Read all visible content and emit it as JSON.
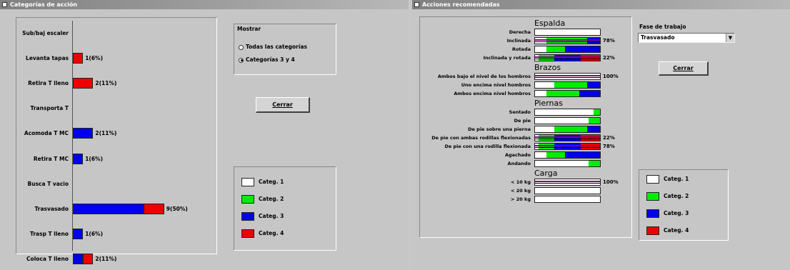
{
  "left_window": {
    "title": "Categorías de acción",
    "mostrar_label": "Mostrar",
    "radio_all": "Todas las categorías",
    "radio_34": "Categorías 3 y 4",
    "close_label": "Cerrar",
    "legend": [
      {
        "label": "Categ. 1",
        "color": "#ffffff"
      },
      {
        "label": "Categ. 2",
        "color": "#00ee00"
      },
      {
        "label": "Categ. 3",
        "color": "#0000ee"
      },
      {
        "label": "Categ. 4",
        "color": "#ee0000"
      }
    ]
  },
  "chart_data": {
    "type": "bar",
    "orientation": "horizontal",
    "categories": [
      "Sub/baj escaler",
      "Levanta tapas",
      "Retira T lleno",
      "Transporta T",
      "Acomoda T MC",
      "Retira T MC",
      "Busca T vacio",
      "Trasvasado",
      "Trasp T lleno",
      "Coloca T lleno"
    ],
    "series": [
      {
        "name": "Categ. 3",
        "values": [
          0,
          0,
          0,
          0,
          2,
          1,
          0,
          7,
          1,
          1
        ]
      },
      {
        "name": "Categ. 4",
        "values": [
          0,
          1,
          2,
          0,
          0,
          0,
          0,
          2,
          0,
          1
        ]
      }
    ],
    "data_labels": [
      "",
      "1(6%)",
      "2(11%)",
      "",
      "2(11%)",
      "1(6%)",
      "",
      "9(50%)",
      "1(6%)",
      "2(11%)"
    ],
    "xlim": [
      0,
      9
    ]
  },
  "right_window": {
    "title": "Acciones recomendadas",
    "fase_label": "Fase de trabajo",
    "fase_value": "Trasvasado",
    "close_label": "Cerrar",
    "legend": [
      {
        "label": "Categ. 1",
        "color": "#ffffff"
      },
      {
        "label": "Categ. 2",
        "color": "#00ee00"
      },
      {
        "label": "Categ. 3",
        "color": "#0000ee"
      },
      {
        "label": "Categ. 4",
        "color": "#ee0000"
      }
    ],
    "groups": [
      {
        "title": "Espalda",
        "rows": [
          {
            "label": "Derecha",
            "marked": false,
            "pct": ""
          },
          {
            "label": "Inclinada",
            "marked": true,
            "pct": "78%"
          },
          {
            "label": "Rotada",
            "marked": false,
            "pct": ""
          },
          {
            "label": "Inclinada y rotada",
            "marked": true,
            "pct": "22%"
          }
        ]
      },
      {
        "title": "Brazos",
        "rows": [
          {
            "label": "Ambos bajo el nivel de los hombros",
            "marked": true,
            "pct": "100%"
          },
          {
            "label": "Uno encima nivel hombros",
            "marked": false,
            "pct": ""
          },
          {
            "label": "Ambos encima nivel hombros",
            "marked": false,
            "pct": ""
          }
        ]
      },
      {
        "title": "Piernas",
        "rows": [
          {
            "label": "Sentado",
            "marked": false,
            "pct": ""
          },
          {
            "label": "De pie",
            "marked": false,
            "pct": ""
          },
          {
            "label": "De pie sobre una pierna",
            "marked": false,
            "pct": ""
          },
          {
            "label": "De pie con ambas rodillas flexionadas",
            "marked": true,
            "pct": "22%"
          },
          {
            "label": "De pie con una rodilla flexionada",
            "marked": true,
            "pct": "78%"
          },
          {
            "label": "Agachado",
            "marked": false,
            "pct": ""
          },
          {
            "label": "Andando",
            "marked": false,
            "pct": ""
          }
        ]
      },
      {
        "title": "Carga",
        "rows": [
          {
            "label": "< 10 kg",
            "marked": true,
            "pct": "100%"
          },
          {
            "label": "< 20 kg",
            "marked": false,
            "pct": ""
          },
          {
            "label": "> 20 kg",
            "marked": false,
            "pct": ""
          }
        ]
      }
    ]
  }
}
